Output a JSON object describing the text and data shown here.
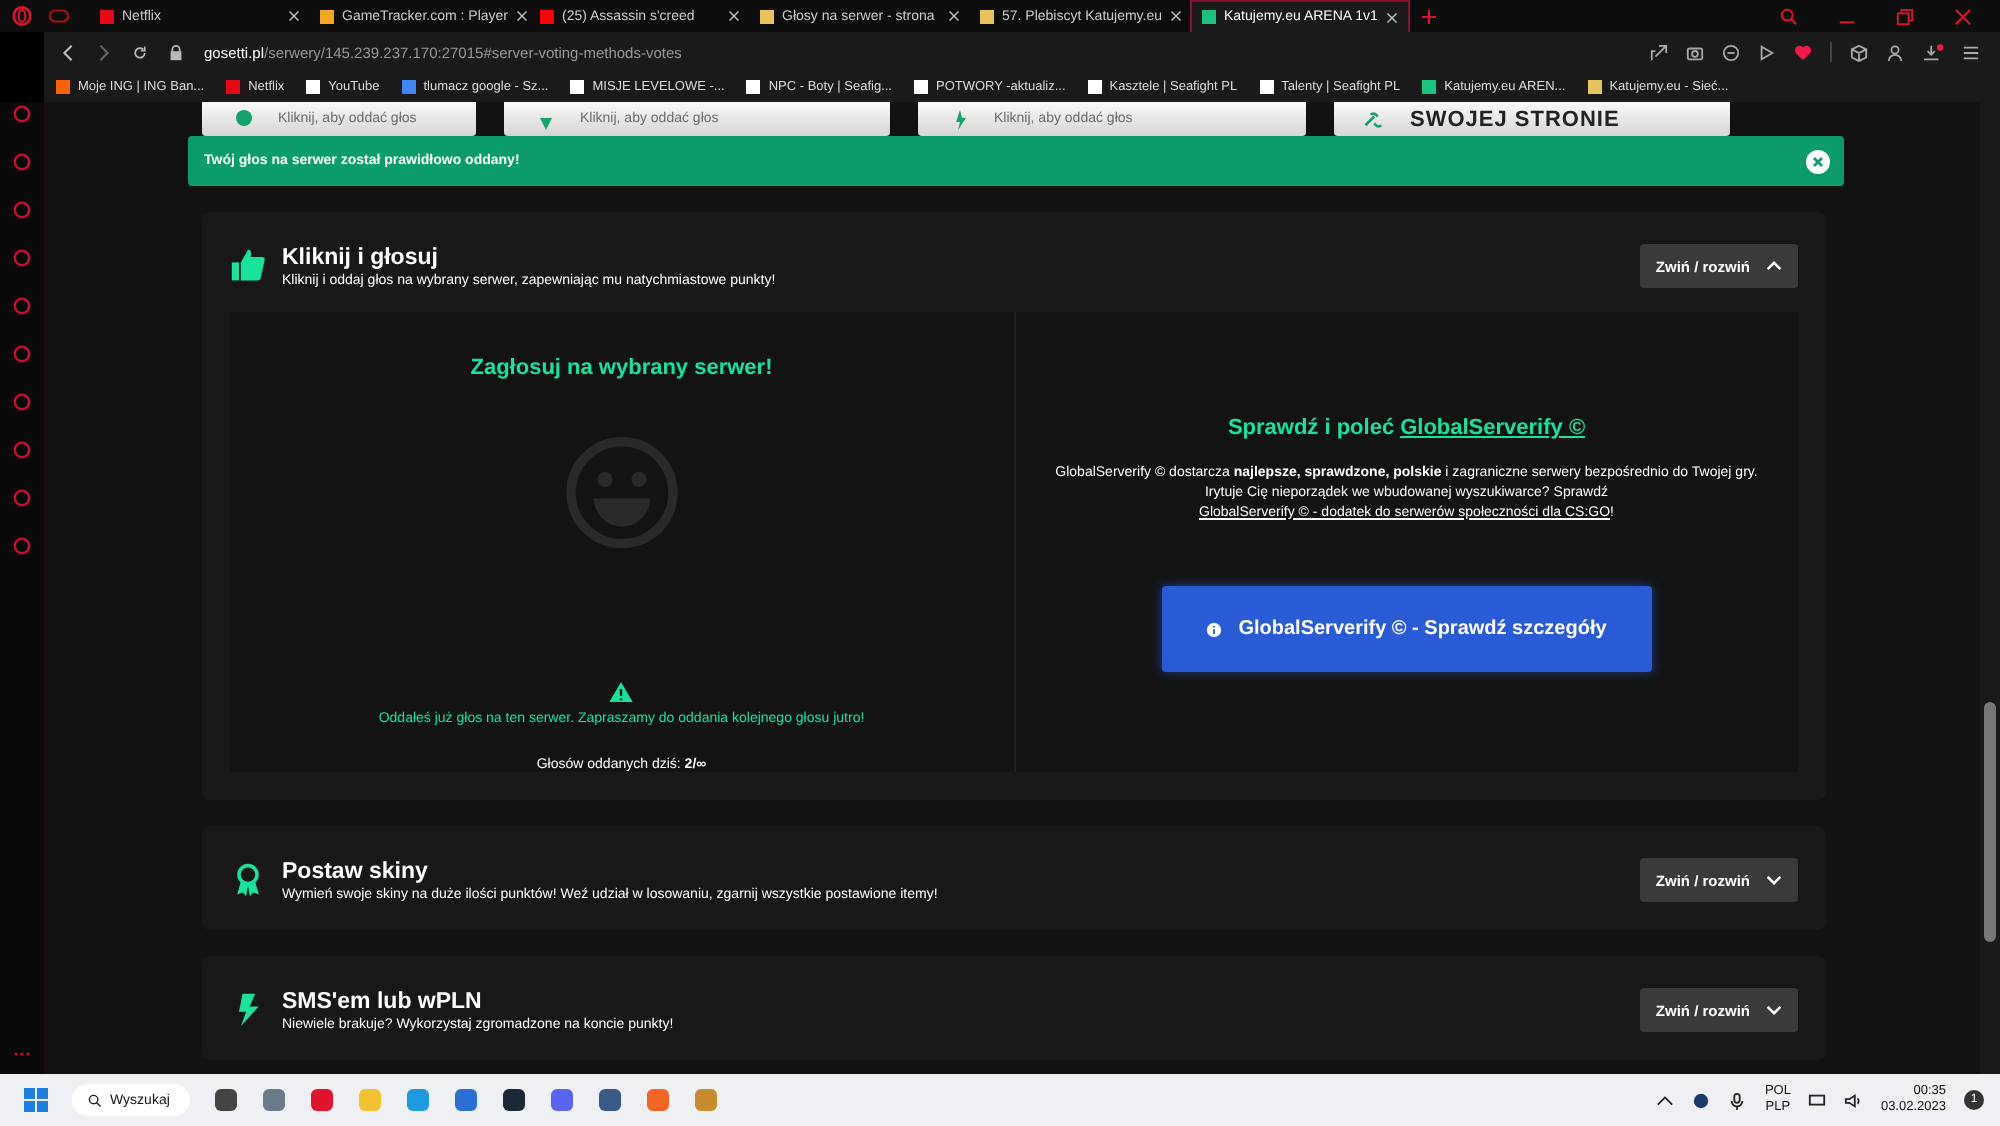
{
  "tabs": [
    {
      "label": "Netflix",
      "selected": false
    },
    {
      "label": "GameTracker.com : Player",
      "selected": false
    },
    {
      "label": "(25) Assassin s'creed",
      "selected": false
    },
    {
      "label": "Głosy na serwer - strona",
      "selected": false
    },
    {
      "label": "57. Plebiscyt Katujemy.eu",
      "selected": false
    },
    {
      "label": "Katujemy.eu ARENA 1v1",
      "selected": true
    }
  ],
  "address": {
    "domain": "gosetti.pl",
    "path": "/serwery/145.239.237.170:27015#server-voting-methods-votes"
  },
  "bookmarks": [
    {
      "label": "Moje ING | ING Ban..."
    },
    {
      "label": "Netflix"
    },
    {
      "label": "YouTube"
    },
    {
      "label": "tlumacz google - Sz..."
    },
    {
      "label": "MISJE LEVELOWE -..."
    },
    {
      "label": "NPC - Boty | Seafig..."
    },
    {
      "label": "POTWORY -aktualiz..."
    },
    {
      "label": "Kasztele | Seafight PL"
    },
    {
      "label": "Talenty | Seafight PL"
    },
    {
      "label": "Katujemy.eu AREN..."
    },
    {
      "label": "Katujemy.eu - Sieć..."
    }
  ],
  "method_cards": [
    {
      "kind": "vote",
      "subtitle": "Kliknij, aby oddać głos"
    },
    {
      "kind": "skins",
      "subtitle": "Kliknij, aby oddać głos"
    },
    {
      "kind": "sms",
      "subtitle": "Kliknij, aby oddać głos"
    },
    {
      "kind": "link",
      "title": "SWOJEJ STRONIE"
    }
  ],
  "notification": {
    "text": "Twój głos na serwer został prawidłowo oddany!"
  },
  "sections": [
    {
      "kind": "vote",
      "title": "Kliknij i głosuj",
      "description": "Kliknij i oddaj głos na wybrany serwer, zapewniając mu natychmiastowe punkty!",
      "toggle": "Zwiń / rozwiń",
      "expanded": true
    },
    {
      "kind": "skins",
      "title": "Postaw skiny",
      "description": "Wymień swoje skiny na duże ilości punktów! Weź udział w losowaniu, zgarnij wszystkie postawione itemy!",
      "toggle": "Zwiń / rozwiń",
      "expanded": false
    },
    {
      "kind": "sms",
      "title": "SMS'em lub wPLN",
      "description": "Niewiele brakuje? Wykorzystaj zgromadzone na koncie punkty!",
      "toggle": "Zwiń / rozwiń",
      "expanded": false
    }
  ],
  "vote_panel": {
    "heading": "Zagłosuj na wybrany serwer!",
    "message": "Oddałeś już głos na ten serwer. Zapraszamy do oddania kolejnego głosu jutro!",
    "votes_today": "Głosów oddanych dziś: **2/∞**"
  },
  "promo_panel": {
    "heading": "Sprawdź i poleć",
    "heading_link": "GlobalServerify ©",
    "text_before": "GlobalServerify © dostarcza **najlepsze, sprawdzone, polskie** i zagraniczne serwery bezpośrednio do Twojej gry. Irytuje Cię nieporządek we wbudowanej wyszukiwarce? Sprawdź",
    "text_link": "GlobalServerify © - dodatek do serwerów społeczności dla CS:GO",
    "text_after": "!",
    "button": "GlobalServerify © - Sprawdź szczegóły"
  },
  "taskbar": {
    "search": "Wyszukaj",
    "language": "POL",
    "layout": "PLP",
    "time": "00:35",
    "date": "03.02.2023",
    "badge": "1"
  }
}
